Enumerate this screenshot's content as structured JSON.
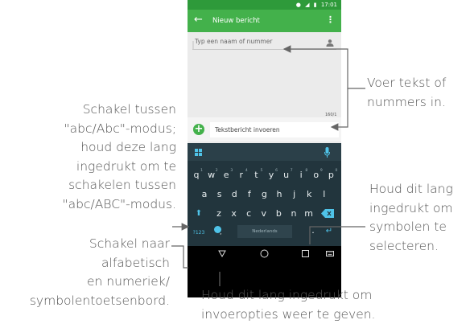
{
  "status_bar": {
    "time": "17:01"
  },
  "app_bar": {
    "back_icon": "arrow-left-icon",
    "title": "Nieuw bericht",
    "menu_icon": "more-vert-icon"
  },
  "recipient": {
    "placeholder": "Typ een naam of nummer",
    "icon": "person-icon"
  },
  "compose": {
    "counter": "160/1",
    "placeholder": "Tekstbericht invoeren",
    "add_icon": "plus-icon"
  },
  "keyboard": {
    "row1": [
      {
        "key": "q",
        "hint": "1"
      },
      {
        "key": "w",
        "hint": "2"
      },
      {
        "key": "e",
        "hint": "3"
      },
      {
        "key": "r",
        "hint": "4"
      },
      {
        "key": "t",
        "hint": "5"
      },
      {
        "key": "y",
        "hint": "6"
      },
      {
        "key": "u",
        "hint": "7"
      },
      {
        "key": "i",
        "hint": "8"
      },
      {
        "key": "o",
        "hint": "9"
      },
      {
        "key": "p",
        "hint": "0"
      }
    ],
    "row2": [
      "a",
      "s",
      "d",
      "f",
      "g",
      "h",
      "j",
      "k",
      "l"
    ],
    "row3": [
      "z",
      "x",
      "c",
      "v",
      "b",
      "n",
      "m"
    ],
    "symbols_key": "?123",
    "emoji_key": ",",
    "space_label": "Nederlands",
    "period_key": ".",
    "shift_icon": "shift-icon",
    "delete_icon": "backspace-icon",
    "enter_icon": "enter-icon",
    "grid_icon": "grid-icon",
    "mic_icon": "mic-icon"
  },
  "nav": {
    "back_icon": "triangle-back-icon",
    "home_icon": "circle-home-icon",
    "recents_icon": "square-recents-icon",
    "keyboard_icon": "keyboard-icon"
  },
  "accent_color": "#43b14b",
  "keyboard_accent": "#4fc3e8",
  "annotations": {
    "left_1": [
      "Schakel tussen",
      "\"abc/Abc\"-modus;",
      "houd deze lang",
      "ingedrukt om te",
      "schakelen tussen",
      "\"abc/ABC\"-modus."
    ],
    "left_2": [
      "Schakel naar",
      "alfabetisch",
      "en numeriek/",
      "symbolentoetsenbord."
    ],
    "right_1": [
      "Voer tekst of",
      "nummers in."
    ],
    "right_2": [
      "Houd dit lang",
      "ingedrukt om",
      "symbolen te",
      "selecteren."
    ],
    "bottom": [
      "Houd dit lang ingedrukt om",
      "invoeropties weer te geven."
    ]
  }
}
